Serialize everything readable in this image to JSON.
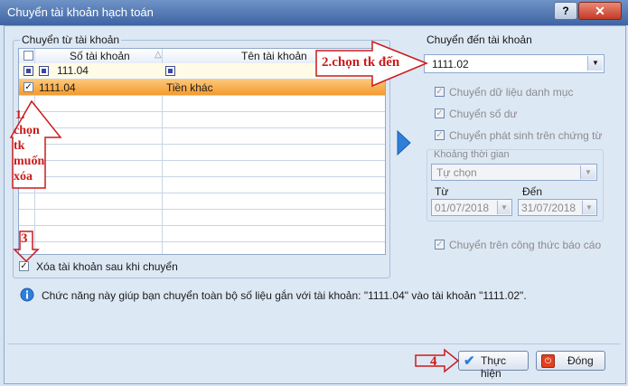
{
  "window": {
    "title": "Chuyển tài khoản hạch toán",
    "help_label": "?",
    "close_label": "✕"
  },
  "from_group": {
    "label": "Chuyển từ tài khoản",
    "columns": [
      "Số tài khoản",
      "Tên tài khoản"
    ],
    "rows": [
      {
        "account": "111.04",
        "name": ""
      },
      {
        "account": "1111.04",
        "name": "Tiền khác"
      }
    ]
  },
  "to_group": {
    "label": "Chuyển đến tài khoản",
    "selected": "1111.02",
    "options": {
      "category_data": "Chuyển dữ liệu danh mục",
      "balance": "Chuyển số dư",
      "vouchers": "Chuyển phát sinh trên chứng từ",
      "formulas": "Chuyển trên công thức báo cáo"
    },
    "period": {
      "label": "Khoảng thời gian",
      "value": "Tự chọn",
      "from_label": "Từ",
      "from_date": "01/07/2018",
      "to_label": "Đến",
      "to_date": "31/07/2018"
    }
  },
  "delete_after": {
    "label": "Xóa tài khoản sau khi chuyển",
    "checked": true
  },
  "info": "Chức năng này giúp bạn chuyển toàn bộ số liệu gắn với tài khoản: \"1111.04\" vào tài khoản \"1111.02\".",
  "buttons": {
    "execute": "Thực hiện",
    "close": "Đóng"
  },
  "annotations": {
    "step1": [
      "1.",
      "chọn",
      "tk",
      "muốn",
      "xóa"
    ],
    "step2": "2.chọn tk đến",
    "step3": "3",
    "step4": "4"
  },
  "colors": {
    "selected_row": "#f6a53b",
    "annotation": "#cc1a1a",
    "accent_arrow": "#2f7fd8"
  }
}
